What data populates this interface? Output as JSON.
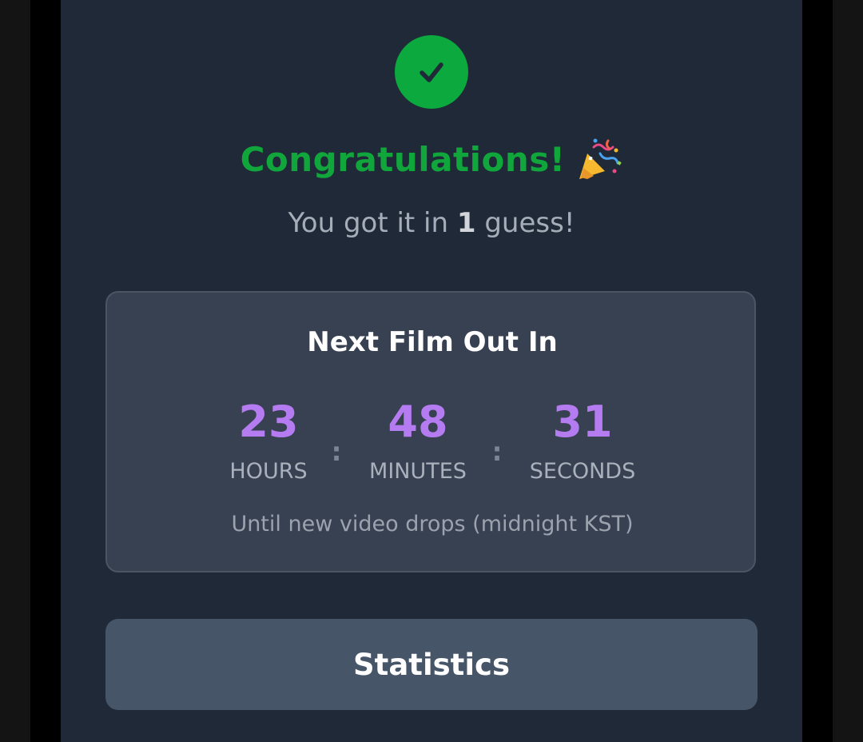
{
  "result": {
    "title": "Congratulations!",
    "guess_prefix": "You got it in ",
    "guess_count": "1",
    "guess_suffix": " guess!"
  },
  "countdown": {
    "title": "Next Film Out In",
    "hours": {
      "value": "23",
      "label": "HOURS"
    },
    "minutes": {
      "value": "48",
      "label": "MINUTES"
    },
    "seconds": {
      "value": "31",
      "label": "SECONDS"
    },
    "separator": ":",
    "note": "Until new video drops (midnight KST)"
  },
  "actions": {
    "statistics_label": "Statistics"
  },
  "icons": {
    "success": "checkmark-icon",
    "celebration": "party-popper-icon"
  },
  "colors": {
    "success_green": "#10a63c",
    "countdown_purple": "#b57cf2",
    "modal_bg": "#1f2937",
    "card_bg": "#374151",
    "button_bg": "#475569"
  }
}
